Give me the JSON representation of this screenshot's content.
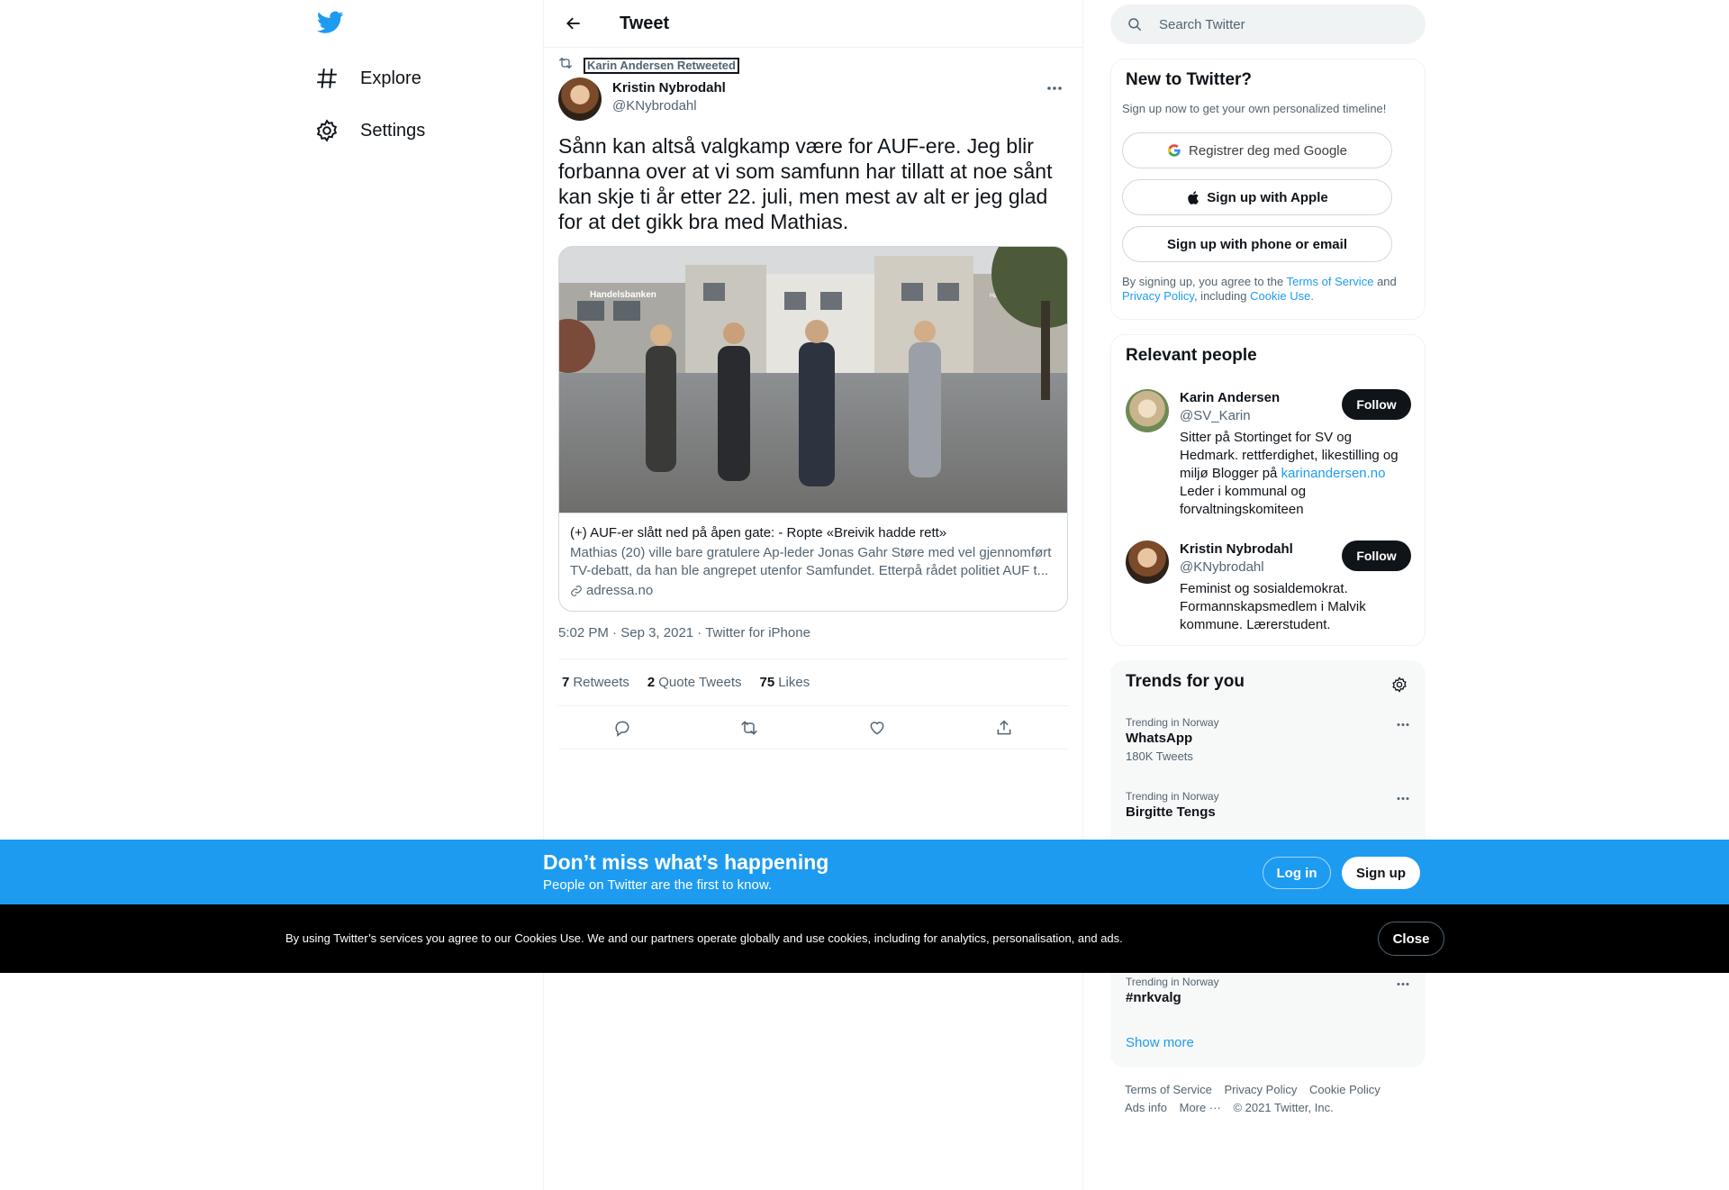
{
  "nav": {
    "logo": "twitter-bird-icon",
    "items": [
      {
        "label": "Explore",
        "icon": "hashtag-icon"
      },
      {
        "label": "Settings",
        "icon": "gear-icon"
      }
    ]
  },
  "header": {
    "title": "Tweet"
  },
  "tweet": {
    "retweeted_by": "Karin Andersen Retweeted",
    "author_name": "Kristin Nybrodahl",
    "author_handle": "@KNybrodahl",
    "text": "Sånn kan altså valgkamp være for AUF-ere. Jeg blir forbanna over at vi som samfunn har tillatt at noe sånt kan skje ti år etter 22. juli, men mest av alt er jeg glad for at det gikk bra med Mathias.",
    "card": {
      "title": "(+) AUF-er slått ned på åpen gate: - Ropte «Breivik hadde rett»",
      "description": "Mathias (20) ville bare gratulere Ap-leder Jonas Gahr Støre med vel gjennomført TV-debatt, da han ble angrepet utenfor Samfundet. Etterpå rådet politiet AUF t...",
      "domain": "adressa.no",
      "image_signs": [
        "Handelsbanken",
        "Hästens"
      ]
    },
    "time": "5:02 PM",
    "date": "Sep 3, 2021",
    "source": "Twitter for iPhone",
    "sep": "·",
    "stats": {
      "retweets": "7",
      "retweets_label": "Retweets",
      "quotes": "2",
      "quotes_label": "Quote Tweets",
      "likes": "75",
      "likes_label": "Likes"
    }
  },
  "search": {
    "placeholder": "Search Twitter"
  },
  "signup": {
    "title": "New to Twitter?",
    "subtitle": "Sign up now to get your own personalized timeline!",
    "google": "Registrer deg med Google",
    "apple": "Sign up with Apple",
    "phone": "Sign up with phone or email",
    "legal_1": "By signing up, you agree to the",
    "terms": "Terms of Service",
    "legal_2": "and",
    "privacy": "Privacy Policy",
    "legal_3": ", including",
    "cookie": "Cookie Use."
  },
  "relevant": {
    "title": "Relevant people",
    "people": [
      {
        "name": "Karin Andersen",
        "handle": "@SV_Karin",
        "bio_1": "Sitter på Stortinget for SV og Hedmark. rettferdighet, likestilling og miljø Blogger på",
        "bio_link": "karinandersen.no",
        "bio_2": "Leder i kommunal og forvaltningskomiteen",
        "follow": "Follow"
      },
      {
        "name": "Kristin Nybrodahl",
        "handle": "@KNybrodahl",
        "bio_1": "Feminist og sosialdemokrat. Formannskapsmedlem i Malvik kommune. Lærerstudent.",
        "follow": "Follow"
      }
    ]
  },
  "trends": {
    "title": "Trends for you",
    "items": [
      {
        "context": "Trending in Norway",
        "name": "WhatsApp",
        "count": "180K Tweets"
      },
      {
        "context": "Trending in Norway",
        "name": "Birgitte Tengs"
      },
      {
        "context": "Trending in Norway",
        "name": "#nrkvalg"
      }
    ],
    "show_more": "Show more"
  },
  "footer": {
    "links": [
      "Terms of Service",
      "Privacy Policy",
      "Cookie Policy",
      "Ads info",
      "More ···"
    ],
    "copyright": "© 2021 Twitter, Inc."
  },
  "bottom_bar": {
    "title": "Don’t miss what’s happening",
    "subtitle": "People on Twitter are the first to know.",
    "login": "Log in",
    "signup": "Sign up"
  },
  "cookie_bar": {
    "text": "By using Twitter’s services you agree to our Cookies Use. We and our partners operate globally and use cookies, including for analytics, personalisation, and ads.",
    "close": "Close"
  },
  "colors": {
    "accent": "#1d9bf0",
    "text": "#0f1419",
    "muted": "#536471",
    "border": "#eff3f4"
  }
}
